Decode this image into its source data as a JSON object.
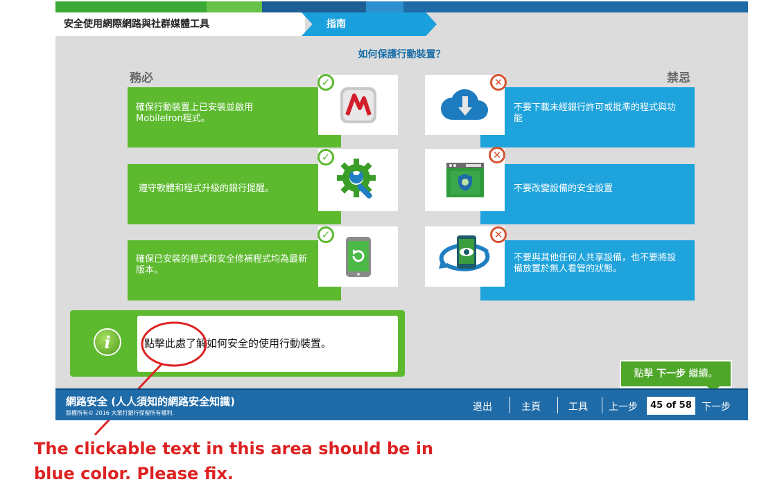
{
  "header": {
    "title": "安全使用網際網路與社群媒體工具",
    "guide_tab": "指南"
  },
  "subtitle": "如何保護行動裝置？",
  "do_heading": "務必",
  "dont_heading": "禁忌",
  "dos": [
    {
      "text": "確保行動裝置上已安裝並啟用 MobileIron程式。",
      "icon": "mobileiron-logo-icon"
    },
    {
      "text": "遵守軟體和程式升級的銀行提醒。",
      "icon": "gear-wrench-icon"
    },
    {
      "text": "確保已安裝的程式和安全修補程式均為最新版本。",
      "icon": "phone-refresh-icon"
    }
  ],
  "donts": [
    {
      "text": "不要下載未經銀行許可或批準的程式與功能",
      "icon": "cloud-download-icon"
    },
    {
      "text": "不要改變設備的安全設置",
      "icon": "browser-security-icon"
    },
    {
      "text": "不要與其他任何人共享設備，也不要將設備放置於無人看管的狀態。",
      "icon": "phone-eye-icon"
    }
  ],
  "info": {
    "icon": "info-icon",
    "text": "點擊此處了解如何安全的使用行動裝置。"
  },
  "tooltip": {
    "pre": "點擊",
    "bold": "下一步",
    "post": "繼續。"
  },
  "footer": {
    "title": "網路安全 (人人須知的網路安全知識)",
    "copyright": "版權所有© 2016 大眾打銀行保留所有權利.",
    "nav": {
      "exit": "退出",
      "home": "主頁",
      "tools": "工具",
      "prev": "上一步",
      "page": "45 of 58",
      "next": "下一步"
    }
  },
  "annotation": {
    "line1": "The clickable text in this area should be in",
    "line2": "blue color. Please fix."
  },
  "colors": {
    "green": "#5dba2f",
    "blue": "#1fa3dc",
    "navy": "#1f6ba8",
    "annotation_red": "#dd2222"
  }
}
